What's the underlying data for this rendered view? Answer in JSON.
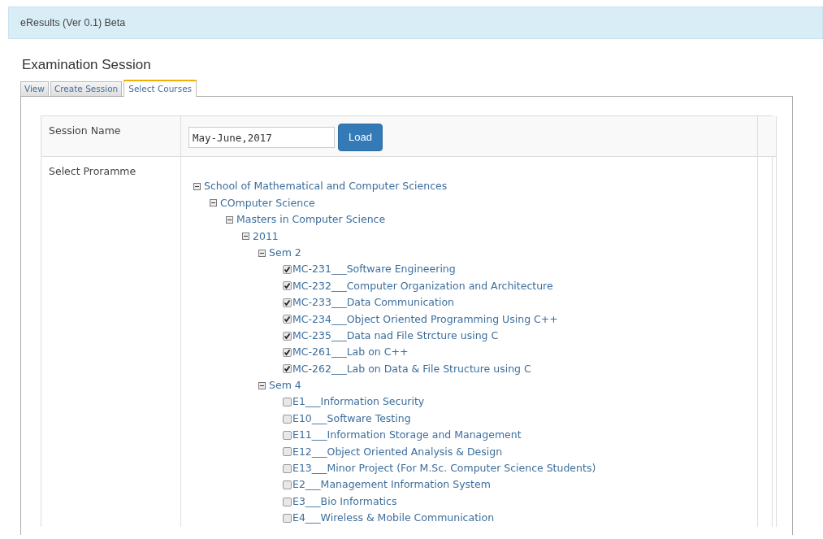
{
  "header": {
    "title": "eResults (Ver 0.1) Beta"
  },
  "heading": "Examination Session",
  "tabs": [
    {
      "label": "View",
      "selected": false
    },
    {
      "label": "Create Session",
      "selected": false
    },
    {
      "label": "Select Courses",
      "selected": true
    }
  ],
  "session": {
    "label": "Session Name",
    "value": "May-June,2017",
    "button": "Load"
  },
  "programme": {
    "label": "Select Proramme",
    "tree": [
      {
        "kind": "group",
        "label": "School of Mathematical and Computer Sciences",
        "expanded": true,
        "children": [
          {
            "kind": "group",
            "label": "COmputer Science",
            "expanded": true,
            "children": [
              {
                "kind": "group",
                "label": "Masters in Computer Science",
                "expanded": true,
                "children": [
                  {
                    "kind": "group",
                    "label": "2011",
                    "expanded": true,
                    "children": [
                      {
                        "kind": "group",
                        "label": "Sem 2",
                        "expanded": true,
                        "children": [
                          {
                            "kind": "course",
                            "label": "MC-231___Software Engineering",
                            "checked": true
                          },
                          {
                            "kind": "course",
                            "label": "MC-232___Computer Organization and Architecture",
                            "checked": true
                          },
                          {
                            "kind": "course",
                            "label": "MC-233___Data Communication",
                            "checked": true
                          },
                          {
                            "kind": "course",
                            "label": "MC-234___Object Oriented Programming Using C++",
                            "checked": true
                          },
                          {
                            "kind": "course",
                            "label": "MC-235___Data nad File Strcture using C",
                            "checked": true
                          },
                          {
                            "kind": "course",
                            "label": "MC-261___Lab on C++",
                            "checked": true
                          },
                          {
                            "kind": "course",
                            "label": "MC-262___Lab on Data & File Structure using C",
                            "checked": true
                          }
                        ]
                      },
                      {
                        "kind": "group",
                        "label": "Sem 4",
                        "expanded": true,
                        "children": [
                          {
                            "kind": "course",
                            "label": "E1___Information Security",
                            "checked": false
                          },
                          {
                            "kind": "course",
                            "label": "E10___Software Testing",
                            "checked": false
                          },
                          {
                            "kind": "course",
                            "label": "E11___Information Storage and Management",
                            "checked": false
                          },
                          {
                            "kind": "course",
                            "label": "E12___Object Oriented Analysis & Design",
                            "checked": false
                          },
                          {
                            "kind": "course",
                            "label": "E13___Minor Project (For M.Sc. Computer Science Students)",
                            "checked": false
                          },
                          {
                            "kind": "course",
                            "label": "E2___Management Information System",
                            "checked": false
                          },
                          {
                            "kind": "course",
                            "label": "E3___Bio Informatics",
                            "checked": false
                          },
                          {
                            "kind": "course",
                            "label": "E4___Wireless & Mobile Communication",
                            "checked": false
                          }
                        ]
                      }
                    ]
                  }
                ]
              }
            ]
          }
        ]
      }
    ]
  }
}
